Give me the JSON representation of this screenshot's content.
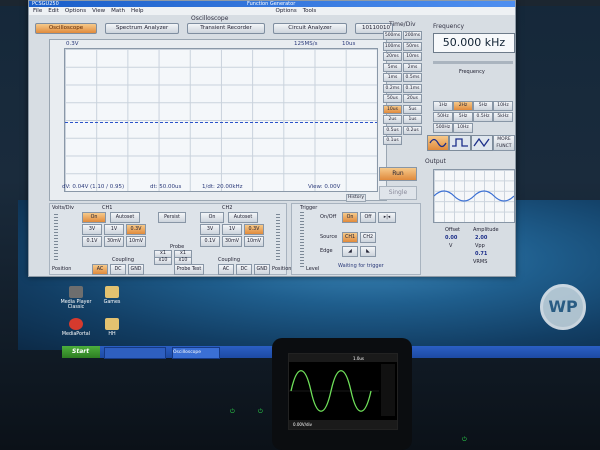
{
  "app": {
    "title": "PCSGU250",
    "menu": [
      "File",
      "Edit",
      "Options",
      "View",
      "Math",
      "Help"
    ],
    "fg_title": "Function Generator",
    "fg_menu": [
      "Options",
      "Tools"
    ]
  },
  "oscilloscope": {
    "section_label": "Oscilloscope",
    "tabs": [
      "Oscilloscope",
      "Spectrum Analyzer",
      "Transient Recorder",
      "Circuit Analyzer",
      "10110010"
    ],
    "readouts": {
      "ch_scale": "0.3V",
      "sample_rate": "125MS/s",
      "time_scale": "10us",
      "dv": "dV: 0.04V",
      "dv_ratio": "(1.10 / 0.95)",
      "dt": "dt: 50.00us",
      "inv_dt": "1/dt: 20.00kHz",
      "view": "View: 0.00V"
    },
    "history_label": "History"
  },
  "time_div": {
    "title": "Time/Div",
    "buttons": [
      "500ms",
      "200ms",
      "100ms",
      "50ms",
      "20ms",
      "10ms",
      "5ms",
      "2ms",
      "1ms",
      "0.5ms",
      "0.2ms",
      "0.1ms",
      "50us",
      "20us",
      "10us",
      "5us",
      "2us",
      "1us",
      "0.5us",
      "0.2us",
      "0.1us"
    ],
    "active": "10us",
    "run": "Run",
    "single": "Single"
  },
  "function_generator": {
    "frequency_title": "Frequency",
    "frequency_value": "50.000 kHz",
    "frequency_label": "Frequency",
    "range_buttons": [
      "1Hz",
      "2Hz",
      "5Hz",
      "10Hz",
      "50Hz",
      "5Hz",
      "0.5Hz",
      "5kHz",
      "500Hz",
      "10Hz"
    ],
    "more_funct": "MORE FUNCT",
    "output_title": "Output",
    "offset_label": "Offset",
    "offset_value": "0.00",
    "offset_unit": "V",
    "amplitude_label": "Amplitude",
    "amplitude_value": "2.00",
    "vpp_label": "Vpp",
    "vrms_value": "0.71",
    "vrms_label": "VRMS"
  },
  "volts_div": {
    "title": "Volts/Div",
    "ch1": "CH1",
    "ch2": "CH2",
    "ch1_buttons": [
      "On",
      "Autoset",
      "3V",
      "1V",
      "0.3V",
      "0.1V",
      "30mV",
      "10mV"
    ],
    "ch2_buttons": [
      "Persist",
      "On",
      "Autoset",
      "3V",
      "1V",
      "0.3V",
      "0.1V",
      "30mV",
      "10mV"
    ],
    "coupling": "Coupling",
    "ac": "AC",
    "dc": "DC",
    "gnd": "GND",
    "probe": "Probe",
    "probe_buttons": [
      "x1",
      "x1",
      "x10",
      "x10"
    ],
    "probe_test": "Probe Test",
    "position": "Position"
  },
  "trigger": {
    "title": "Trigger",
    "onoff_label": "On/Off",
    "on": "On",
    "off": "Off",
    "source_label": "Source",
    "ch1": "CH1",
    "ch2": "CH2",
    "edge_label": "Edge",
    "level_label": "Level",
    "status": "Waiting for trigger"
  },
  "desktop": {
    "icons": [
      "Media Player Classic",
      "Games",
      "MediaPortal",
      "HH"
    ],
    "start": "Start",
    "task1": "Oscilloscope"
  },
  "handheld": {
    "readout_top": "1.0us",
    "readout_bottom": "0.00V/div"
  },
  "colors": {
    "accent": "#e08a3c",
    "trace": "#2a52c9",
    "handheld_trace": "#6fe05a"
  }
}
